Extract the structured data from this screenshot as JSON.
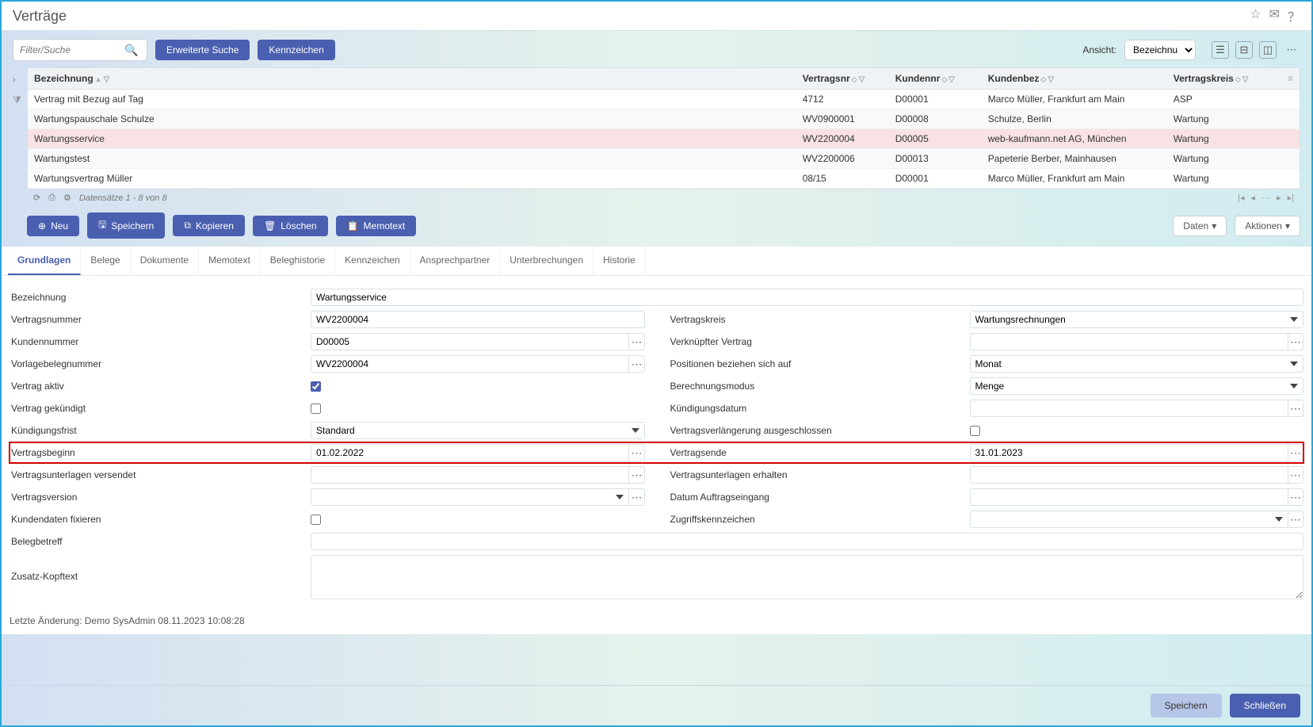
{
  "title": "Verträge",
  "toolbar": {
    "search_placeholder": "Filter/Suche",
    "advanced_search": "Erweiterte Suche",
    "kennzeichen": "Kennzeichen",
    "ansicht_label": "Ansicht:",
    "ansicht_value": "Bezeichnung"
  },
  "table": {
    "headers": {
      "bezeichnung": "Bezeichnung",
      "vertragsnr": "Vertragsnr",
      "kundennr": "Kundennr",
      "kundenbez": "Kundenbez",
      "vertragskreis": "Vertragskreis"
    },
    "rows": [
      {
        "bez": "Vertrag mit Bezug auf Tag",
        "vnr": "4712",
        "knr": "D00001",
        "kbez": "Marco Müller, Frankfurt am Main",
        "vk": "ASP"
      },
      {
        "bez": "Wartungspauschale Schulze",
        "vnr": "WV0900001",
        "knr": "D00008",
        "kbez": "Schulze, Berlin",
        "vk": "Wartung"
      },
      {
        "bez": "Wartungsservice",
        "vnr": "WV2200004",
        "knr": "D00005",
        "kbez": "web-kaufmann.net AG, München",
        "vk": "Wartung"
      },
      {
        "bez": "Wartungstest",
        "vnr": "WV2200006",
        "knr": "D00013",
        "kbez": "Papeterie Berber, Mainhausen",
        "vk": "Wartung"
      },
      {
        "bez": "Wartungsvertrag Müller",
        "vnr": "08/15",
        "knr": "D00001",
        "kbez": "Marco Müller, Frankfurt am Main",
        "vk": "Wartung"
      }
    ],
    "status_info": "Datensätze 1 - 8 von 8"
  },
  "actions": {
    "neu": "Neu",
    "speichern": "Speichern",
    "kopieren": "Kopieren",
    "loeschen": "Löschen",
    "memotext": "Memotext",
    "daten": "Daten",
    "aktionen": "Aktionen"
  },
  "tabs": [
    "Grundlagen",
    "Belege",
    "Dokumente",
    "Memotext",
    "Beleghistorie",
    "Kennzeichen",
    "Ansprechpartner",
    "Unterbrechungen",
    "Historie"
  ],
  "form": {
    "left": {
      "bezeichnung_label": "Bezeichnung",
      "bezeichnung": "Wartungsservice",
      "vertragsnummer_label": "Vertragsnummer",
      "vertragsnummer": "WV2200004",
      "kundennummer_label": "Kundennummer",
      "kundennummer": "D00005",
      "vorlagebelegnummer_label": "Vorlagebelegnummer",
      "vorlagebelegnummer": "WV2200004",
      "vertrag_aktiv_label": "Vertrag aktiv",
      "vertrag_gekuendigt_label": "Vertrag gekündigt",
      "kuendigungsfrist_label": "Kündigungsfrist",
      "kuendigungsfrist": "Standard",
      "vertragsbeginn_label": "Vertragsbeginn",
      "vertragsbeginn": "01.02.2022",
      "vertragsunterlagen_versendet_label": "Vertragsunterlagen versendet",
      "vertragsunterlagen_versendet": "",
      "vertragsversion_label": "Vertragsversion",
      "vertragsversion": "",
      "kundendaten_fixieren_label": "Kundendaten fixieren",
      "belegbetreff_label": "Belegbetreff",
      "belegbetreff": "",
      "zusatz_kopftext_label": "Zusatz-Kopftext",
      "zusatz_kopftext": ""
    },
    "right": {
      "vertragskreis_label": "Vertragskreis",
      "vertragskreis": "Wartungsrechnungen",
      "verknuepfter_vertrag_label": "Verknüpfter Vertrag",
      "verknuepfter_vertrag": "",
      "positionen_label": "Positionen beziehen sich auf",
      "positionen": "Monat",
      "berechnungsmodus_label": "Berechnungsmodus",
      "berechnungsmodus": "Menge",
      "kuendigungsdatum_label": "Kündigungsdatum",
      "kuendigungsdatum": "",
      "verl_ausgeschlossen_label": "Vertragsverlängerung ausgeschlossen",
      "vertragsende_label": "Vertragsende",
      "vertragsende": "31.01.2023",
      "vertragsunterlagen_erhalten_label": "Vertragsunterlagen erhalten",
      "vertragsunterlagen_erhalten": "",
      "datum_auftragseingang_label": "Datum Auftragseingang",
      "datum_auftragseingang": "",
      "zugriffskennzeichen_label": "Zugriffskennzeichen",
      "zugriffskennzeichen": ""
    }
  },
  "last_change": "Letzte Änderung: Demo SysAdmin 08.11.2023 10:08:28",
  "footer": {
    "speichern": "Speichern",
    "schliessen": "Schließen"
  }
}
